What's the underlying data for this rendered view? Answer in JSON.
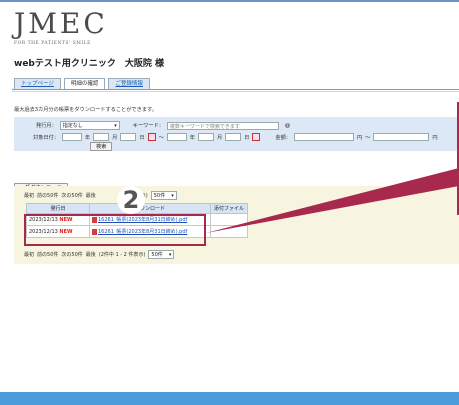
{
  "brand": {
    "logo": "JMEC",
    "tagline": "FOR THE PATIENTS' SMILE"
  },
  "clinic_name": "webテスト用クリニック　大阪院 様",
  "tabs": [
    {
      "label": "トップページ"
    },
    {
      "label": "明細の確認"
    },
    {
      "label": "ご登録情報"
    }
  ],
  "notice": "最大過去3カ月分の帳票をダウンロードすることができます。",
  "search": {
    "issue_month_label": "発行月：",
    "issue_month_value": "指定なし",
    "keyword_label": "キーワード：",
    "keyword_placeholder": "複数キーワードで検索できます",
    "period_label": "対象日付：",
    "year": "年",
    "month": "月",
    "day": "日",
    "tilde": "～",
    "amount_label": "金額：",
    "yen": "円",
    "search_button": "検索"
  },
  "bulk_download": "一括ダウンロード",
  "pager_top": {
    "first": "最初",
    "prev": "前の50件",
    "next": "次の50件",
    "last": "最後",
    "count": "件表示)",
    "per_page": "50件"
  },
  "pager_bottom": {
    "first": "最初",
    "prev": "前の50件",
    "next": "次の50件",
    "last": "最後",
    "count": "(2件中 1 - 2 件表示)",
    "per_page": "50件"
  },
  "table": {
    "headers": [
      "発行日",
      "ダウンロード",
      "添付ファイル"
    ],
    "rows": [
      {
        "date": "2023/12/13",
        "badge": "NEW",
        "file": "16261_帳票(2023年8月31日締め).pdf"
      },
      {
        "date": "2023/12/13",
        "badge": "NEW",
        "file": "16261_帳票(2023年8月31日締め).pdf"
      }
    ]
  },
  "step_badge": "2",
  "colors": {
    "highlight": "#a8294e",
    "new": "#e0201c",
    "link": "#1a4db8",
    "footer": "#4c9bdb"
  }
}
